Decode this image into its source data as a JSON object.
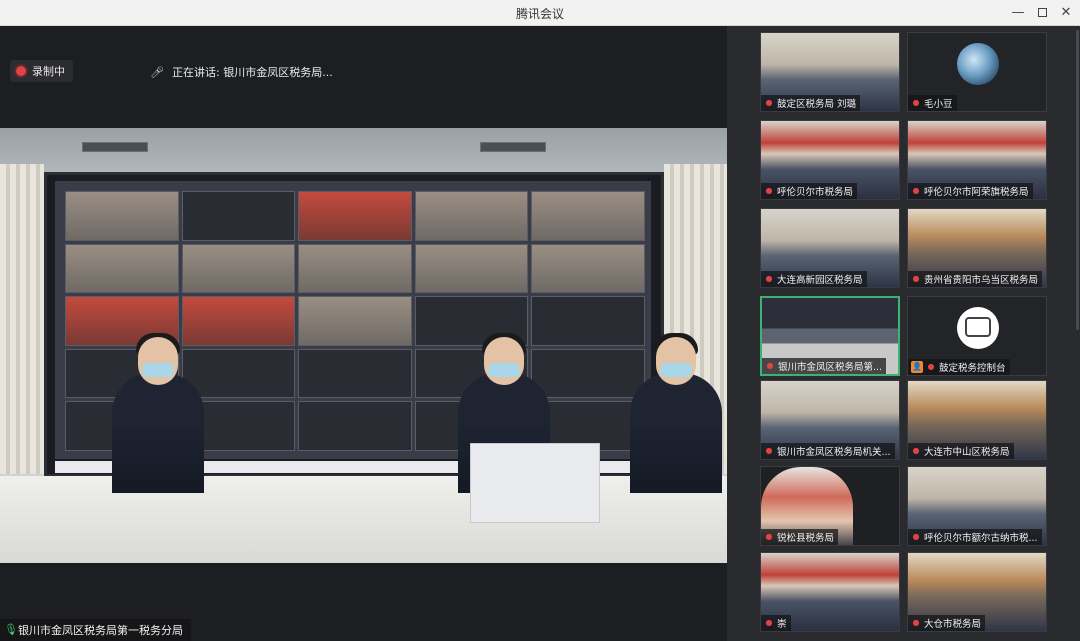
{
  "window": {
    "title": "腾讯会议",
    "minimize_glyph": "—",
    "close_glyph": "✕"
  },
  "main": {
    "recording_label": "录制中",
    "speaking_prefix": "正在讲话:",
    "speaking_name": "银川市金凤区税务局...",
    "main_participant": "银川市金凤区税务局第一税务分局"
  },
  "participants": [
    {
      "name": "鼓定区税务局 刘璐",
      "style": "room"
    },
    {
      "name": "毛小豆",
      "style": "globe"
    },
    {
      "name": "呼伦贝尔市税务局",
      "style": "red"
    },
    {
      "name": "呼伦贝尔市阿荣旗税务局",
      "style": "red"
    },
    {
      "name": "大连高新园区税务局",
      "style": "room"
    },
    {
      "name": "贵州省贵阳市乌当区税务局",
      "style": "wood"
    },
    {
      "name": "银川市金凤区税务局第...",
      "style": "screen"
    },
    {
      "name": "鼓定税务控制台",
      "style": "meeting"
    },
    {
      "name": "银川市金凤区税务局机关...",
      "style": "room"
    },
    {
      "name": "大连市中山区税务局",
      "style": "wood"
    },
    {
      "name": "锐松县税务局",
      "style": "person"
    },
    {
      "name": "呼伦贝尔市额尔古纳市税...",
      "style": "room"
    },
    {
      "name": "崇",
      "style": "red"
    },
    {
      "name": "大仓市税务局",
      "style": "wood"
    }
  ],
  "colors": {
    "recording": "#e04343",
    "active_speaker_border": "#3cb371",
    "mic_on": "#47c36a",
    "mic_off": "#e04343"
  },
  "icons": {
    "recording": "record-dot-icon",
    "speaking": "mic-icon",
    "participant_mic": "mic-off-icon",
    "host": "people-icon"
  }
}
